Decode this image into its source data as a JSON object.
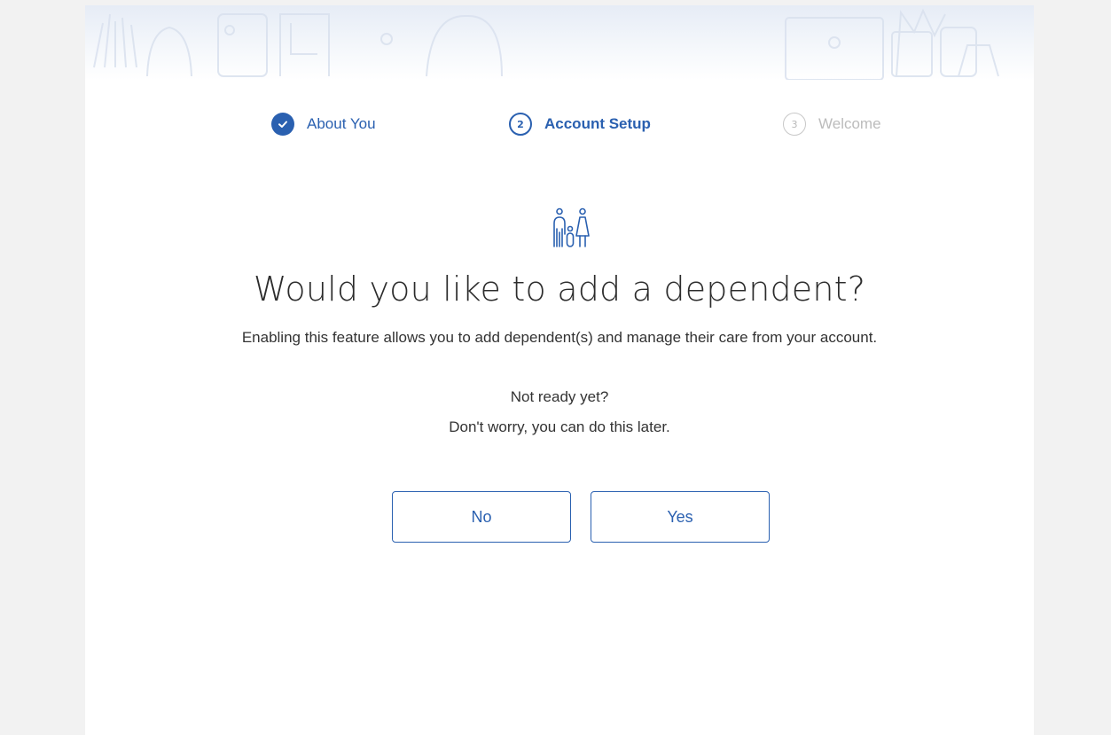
{
  "stepper": {
    "steps": [
      {
        "number": "",
        "label": "About You",
        "state": "done",
        "icon": "check-icon"
      },
      {
        "number": "2",
        "label": "Account Setup",
        "state": "active"
      },
      {
        "number": "3",
        "label": "Welcome",
        "state": "pending"
      }
    ]
  },
  "main": {
    "icon": "family-icon",
    "title": "Would you like to add a dependent?",
    "subtitle": "Enabling this feature allows you to add dependent(s) and manage their care from your account.",
    "note_line1": "Not ready yet?",
    "note_line2": "Don't worry, you can do this later."
  },
  "actions": {
    "no_label": "No",
    "yes_label": "Yes"
  },
  "colors": {
    "accent": "#2a60b0",
    "pending": "#bcbcbc",
    "text": "#333333"
  }
}
